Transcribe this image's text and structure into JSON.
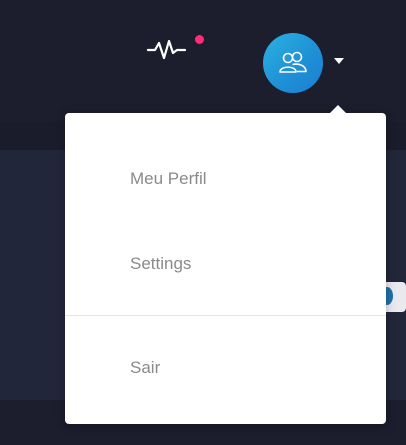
{
  "header": {
    "activity_icon": "activity-pulse-icon",
    "notification_dot_color": "#ff2d78",
    "avatar_icon": "users-icon",
    "caret_icon": "caret-down-icon"
  },
  "dropdown": {
    "items": [
      {
        "label": "Meu Perfil"
      },
      {
        "label": "Settings"
      },
      {
        "label": "Sair"
      }
    ]
  },
  "colors": {
    "topbar_bg": "#1c1d2d",
    "avatar_gradient_start": "#2bb3e0",
    "avatar_gradient_end": "#1b7fd0",
    "menu_text": "#8a8a8a"
  }
}
